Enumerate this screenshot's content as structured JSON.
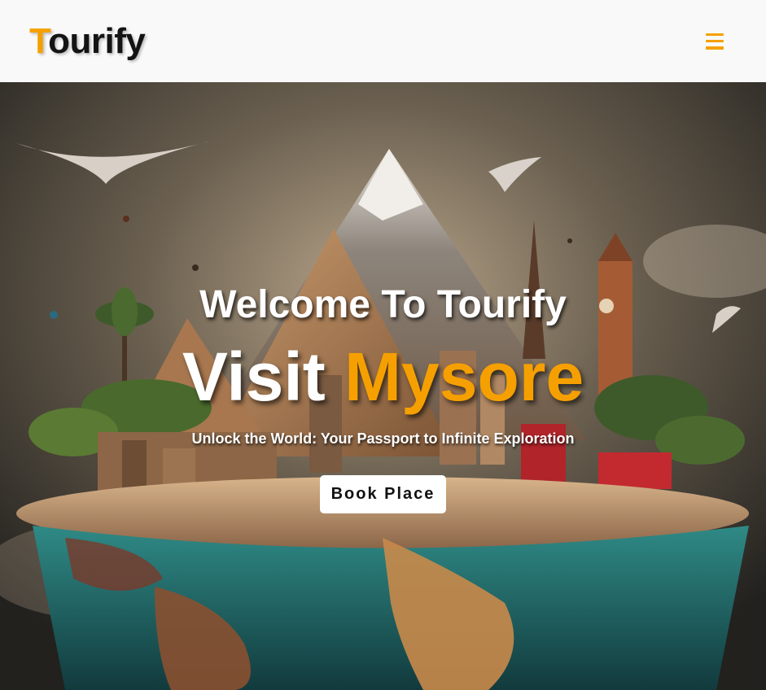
{
  "nav": {
    "logo_first": "T",
    "logo_rest": "ourify",
    "menu_icon": "hamburger-icon"
  },
  "hero": {
    "welcome": "Welcome To Tourify",
    "visit": "Visit",
    "city": "Mysore",
    "tagline": "Unlock the World: Your Passport to Infinite Exploration",
    "cta_label": "Book Place"
  },
  "colors": {
    "accent": "#f5a000",
    "nav_bg": "#f9f9f9",
    "text_light": "#ffffff"
  }
}
